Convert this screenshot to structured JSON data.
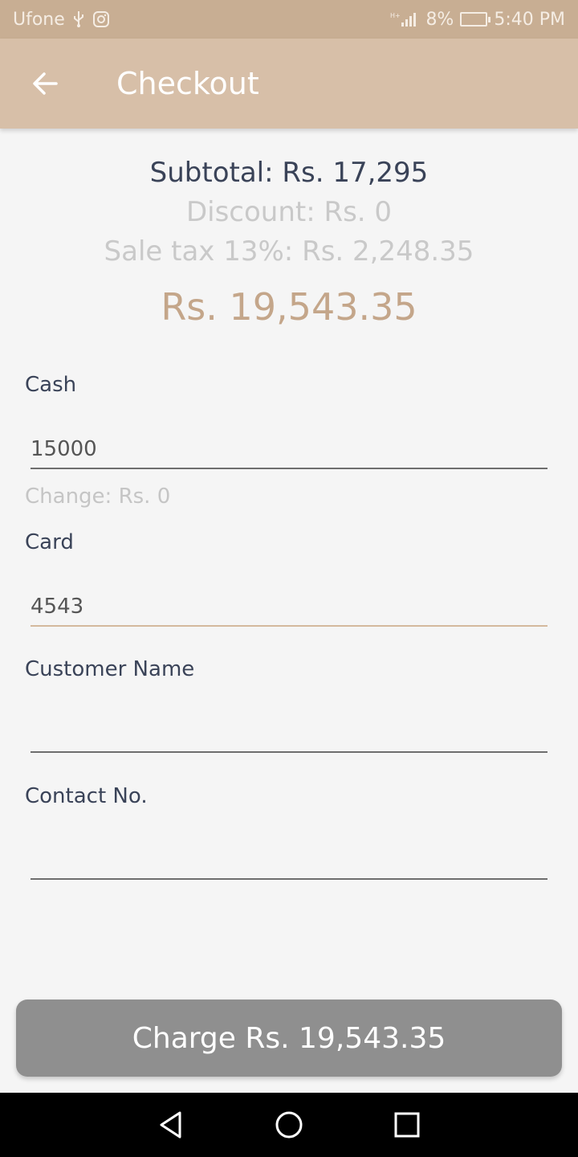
{
  "status_bar": {
    "carrier": "Ufone",
    "signal": "H+",
    "battery": "8%",
    "time": "5:40 PM"
  },
  "app_bar": {
    "title": "Checkout"
  },
  "summary": {
    "subtotal": "Subtotal: Rs. 17,295",
    "discount": "Discount: Rs. 0",
    "tax": "Sale tax 13%: Rs. 2,248.35",
    "total": "Rs. 19,543.35"
  },
  "form": {
    "cash_label": "Cash",
    "cash_value": "15000",
    "change_text": "Change: Rs. 0",
    "card_label": "Card",
    "card_value": "4543",
    "customer_label": "Customer Name",
    "customer_value": "",
    "contact_label": "Contact No.",
    "contact_value": ""
  },
  "charge_button": {
    "label": "Charge Rs. 19,543.35"
  },
  "colors": {
    "status_bar": "#c8ae93",
    "app_bar": "#d7bfa8",
    "accent": "#c4a68a",
    "button": "#8f8f8f"
  }
}
